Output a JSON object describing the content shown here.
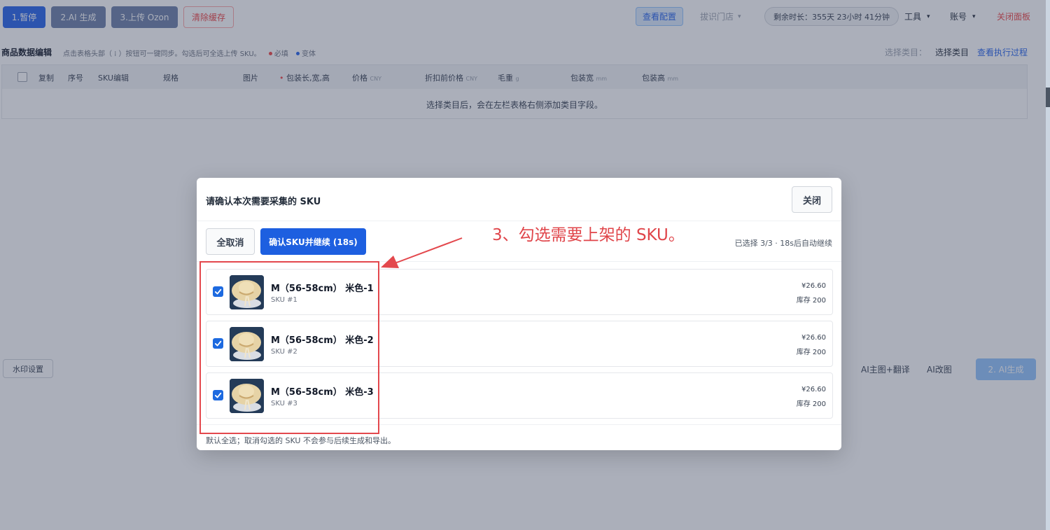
{
  "topbar": {
    "buttons": [
      "1.暂停",
      "2.AI 生成",
      "3.上传 Ozon",
      "清除缓存"
    ],
    "check_config": "查看配置",
    "store_select": "拔识门店",
    "expiry": "剩余时长：355天 23小时 41分钟",
    "tools": "工具",
    "account": "账号",
    "close_panel": "关闭面板"
  },
  "section": {
    "title": "商品数据编辑",
    "hint": "点击表格头部（ ⁞ ）按钮可一键同步。勾选后可全选上传 SKU。",
    "legend_required": "必填",
    "legend_optional": "变体",
    "select_category_label": "选择类目：",
    "select_category_value": "选择类目",
    "view_log": "查看执行过程"
  },
  "table": {
    "headers": [
      "复制",
      "序号",
      "SKU编辑",
      "规格",
      "图片",
      "包装长,宽,高",
      "价格",
      "折扣前价格",
      "毛重",
      "包装宽",
      "包装高"
    ],
    "header_units": [
      "",
      "",
      "",
      "",
      "",
      "",
      "CNY",
      "CNY",
      "g",
      "mm",
      "mm"
    ],
    "empty": "选择类目后，会在左栏表格右侧添加类目字段。"
  },
  "bottombar": {
    "watermark": "水印设置",
    "ai_title": "AI主图+翻译",
    "ai_image": "AI改图",
    "ai_generate": "2. AI生成"
  },
  "dialog": {
    "title": "请确认本次需要采集的 SKU",
    "close": "关闭",
    "deselect_all": "全取消",
    "confirm": "确认SKU并继续 (18s)",
    "status": "已选择 3/3 · 18s后自动继续",
    "footnote": "默认全选；取消勾选的 SKU 不会参与后续生成和导出。",
    "skus": [
      {
        "name": "M（56-58cm） 米色-1",
        "sub": "SKU #1",
        "price": "¥26.60",
        "stock": "库存 200",
        "checked": true
      },
      {
        "name": "M（56-58cm） 米色-2",
        "sub": "SKU #2",
        "price": "¥26.60",
        "stock": "库存 200",
        "checked": true
      },
      {
        "name": "M（56-58cm） 米色-3",
        "sub": "SKU #3",
        "price": "¥26.60",
        "stock": "库存 200",
        "checked": true
      }
    ]
  },
  "annotation": {
    "text": "3、勾选需要上架的 SKU。",
    "color": "#e0454a"
  }
}
